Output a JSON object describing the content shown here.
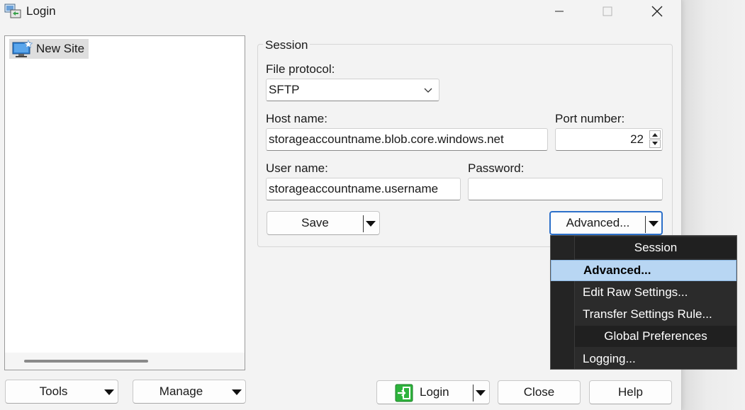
{
  "window": {
    "title": "Login"
  },
  "tree": {
    "items": [
      {
        "label": "New Site"
      }
    ]
  },
  "session": {
    "group_label": "Session",
    "file_protocol_label": "File protocol:",
    "file_protocol_value": "SFTP",
    "host_label": "Host name:",
    "host_value": "storageaccountname.blob.core.windows.net",
    "port_label": "Port number:",
    "port_value": "22",
    "user_label": "User name:",
    "user_value": "storageaccountname.username",
    "password_label": "Password:",
    "password_value": "",
    "save_label": "Save",
    "advanced_label": "Advanced..."
  },
  "advanced_menu": {
    "items": [
      {
        "label": "Session",
        "type": "header"
      },
      {
        "label": "Advanced...",
        "type": "item",
        "highlighted": true
      },
      {
        "label": "Edit Raw Settings...",
        "type": "item"
      },
      {
        "label": "Transfer Settings Rule...",
        "type": "item"
      },
      {
        "label": "Global Preferences",
        "type": "header"
      },
      {
        "label": "Logging...",
        "type": "item"
      }
    ]
  },
  "bottom": {
    "tools_label": "Tools",
    "manage_label": "Manage",
    "login_label": "Login",
    "close_label": "Close",
    "help_label": "Help"
  },
  "colors": {
    "highlight": "#b8d6f3",
    "focus_border": "#2b6fc9",
    "login_icon": "#2db33c"
  }
}
